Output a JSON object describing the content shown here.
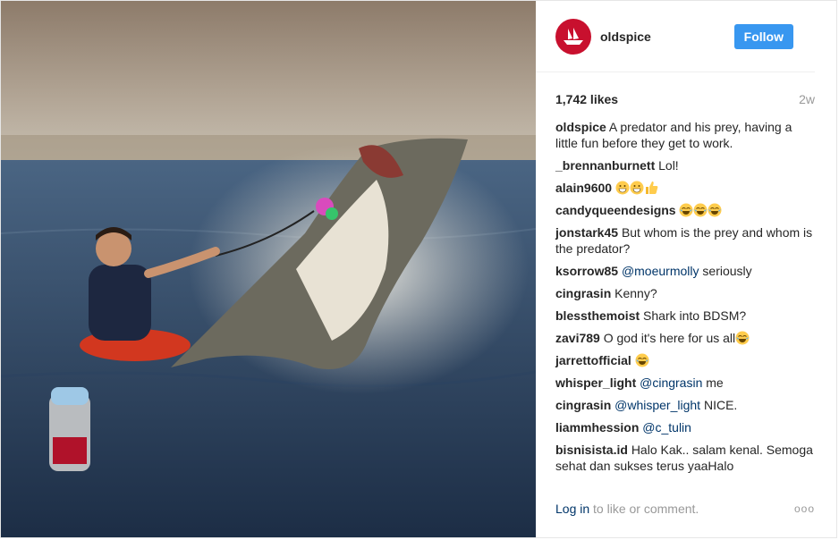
{
  "account": {
    "username": "oldspice"
  },
  "header": {
    "follow_label": "Follow"
  },
  "stats": {
    "likes": "1,742 likes",
    "age": "2w"
  },
  "caption": {
    "username": "oldspice",
    "text": "A predator and his prey, having a little fun before they get to work."
  },
  "comments": [
    {
      "user": "_brennanburnett",
      "text": "Lol!"
    },
    {
      "user": "alain9600",
      "text": "",
      "emoji": [
        "grin",
        "grin",
        "thumbs-up"
      ]
    },
    {
      "user": "candyqueendesigns",
      "text": "",
      "emoji": [
        "tears-of-joy",
        "tears-of-joy",
        "tears-of-joy"
      ]
    },
    {
      "user": "jonstark45",
      "text": "But whom is the prey and whom is the predator?"
    },
    {
      "user": "ksorrow85",
      "mention": "@moeurmolly",
      "text": "seriously"
    },
    {
      "user": "cingrasin",
      "text": "Kenny?"
    },
    {
      "user": "blessthemoist",
      "text": "Shark into BDSM?"
    },
    {
      "user": "zavi789",
      "text": "O god it's here for us all",
      "emoji": [
        "tears-of-joy"
      ]
    },
    {
      "user": "jarrettofficial",
      "text": "",
      "emoji": [
        "tears-of-joy"
      ]
    },
    {
      "user": "whisper_light",
      "mention": "@cingrasin",
      "text": "me"
    },
    {
      "user": "cingrasin",
      "mention": "@whisper_light",
      "text": "NICE."
    },
    {
      "user": "liammhession",
      "mention": "@c_tulin",
      "text": ""
    },
    {
      "user": "bisnisista.id",
      "text": "Halo Kak.. salam kenal. Semoga sehat dan sukses terus yaaHalo"
    }
  ],
  "footer": {
    "login_link": "Log in",
    "login_rest": "to like or comment.",
    "more": "ooo"
  },
  "colors": {
    "follow_button": "#3897f0",
    "link": "#003569",
    "muted": "#999999",
    "avatar_bg": "#c8102e"
  }
}
